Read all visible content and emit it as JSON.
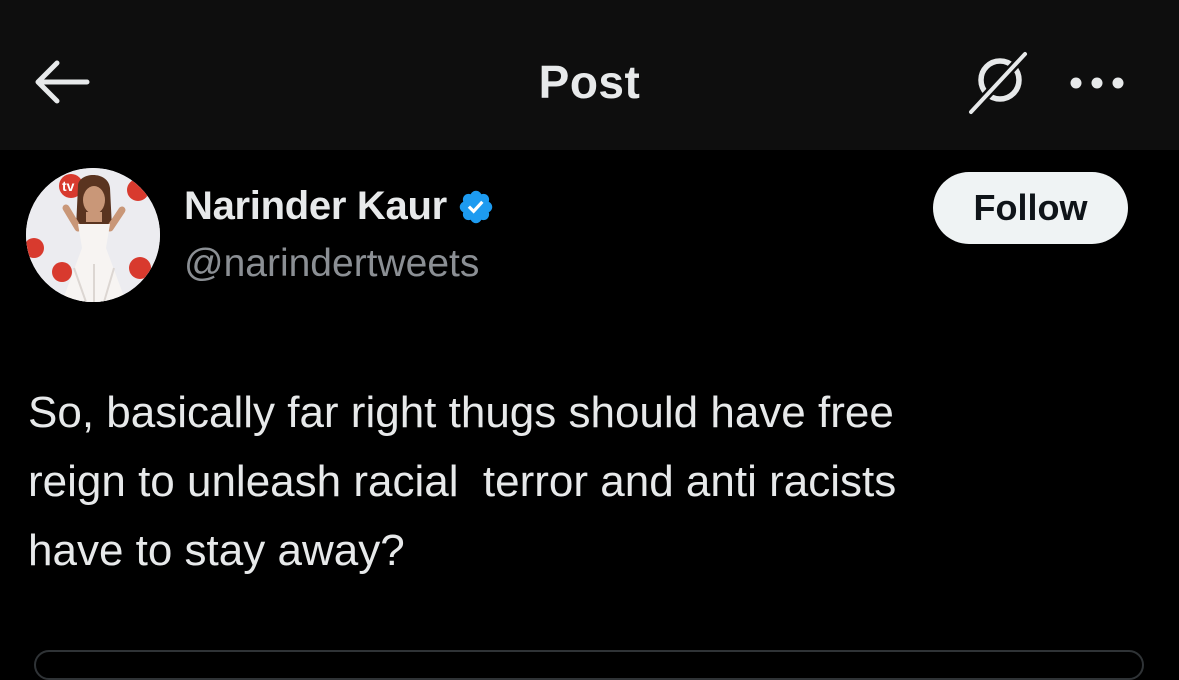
{
  "header": {
    "title": "Post",
    "back_icon": "arrow-left-icon",
    "grok_icon": "grok-icon",
    "more_icon": "more-horizontal-icon"
  },
  "author": {
    "display_name": "Narinder Kaur",
    "handle": "@narindertweets",
    "verified": true,
    "verified_color": "#1d9bf0",
    "avatar_badge_text": "tv"
  },
  "follow_button": {
    "label": "Follow"
  },
  "post": {
    "text": "So, basically far right thugs should have free\nreign to unleash racial  terror and anti racists\nhave to stay away?"
  },
  "colors": {
    "background": "#000000",
    "header_bg": "#0e0e0e",
    "text": "#e7e9ea",
    "secondary_text": "#8b8f94",
    "accent": "#1d9bf0"
  }
}
